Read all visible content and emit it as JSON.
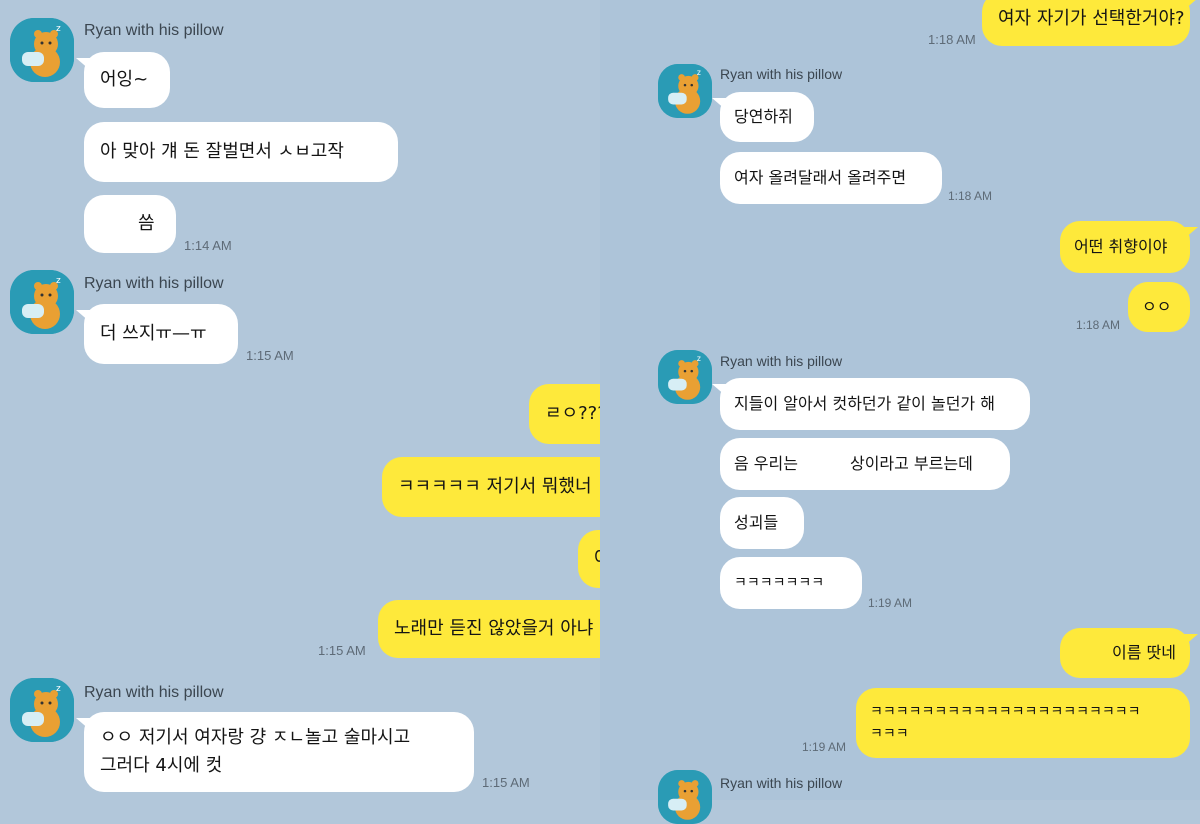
{
  "theme": {
    "background": "#b2c7da",
    "incoming_bubble": "#ffffff",
    "outgoing_bubble": "#fee93b",
    "avatar_bg": "#2a9bb5",
    "avatar_character": "#e9a033",
    "avatar_icon": "ryan-pillow-icon"
  },
  "left": {
    "group1": {
      "sender": "Ryan with his pillow",
      "msgs": [
        "어잉~",
        "아 맞아 걔 돈 잘벌면서 ㅅㅂ고작",
        "씀"
      ],
      "time": "1:14 AM"
    },
    "group2": {
      "sender": "Ryan with his pillow",
      "msgs": [
        "더 쓰지ㅠ—ㅠ"
      ],
      "time": "1:15 AM"
    },
    "group3": {
      "msgs": [
        "ㄹㅇ???",
        "ㅋㅋㅋㅋㅋ 저기서 뭐했너",
        "어",
        "노래만 듣진 않았을거 아냐"
      ],
      "time": "1:15 AM"
    },
    "group4": {
      "sender": "Ryan with his pillow",
      "line1": "ㅇㅇ 저기서 여자랑 걍 ㅈㄴ놀고 술마시고",
      "line2": "그러다 4시에 컷",
      "time": "1:15 AM"
    }
  },
  "right": {
    "top": {
      "msg": "여자 자기가 선택한거야?",
      "time": "1:18 AM"
    },
    "group1": {
      "sender": "Ryan with his pillow",
      "msgs": [
        "당연하쥐",
        "여자 올려달래서 올려주면"
      ],
      "time": "1:18 AM"
    },
    "group2": {
      "msgs": [
        "어떤 취향이야",
        "ㅇㅇ"
      ],
      "time": "1:18 AM"
    },
    "group3": {
      "sender": "Ryan with his pillow",
      "msgs": [
        "지들이 알아서 컷하던가 같이 놀던가 해",
        "음 우리는",
        "상이라고 부르는데",
        "성괴들",
        "ㅋㅋㅋㅋㅋㅋㅋ"
      ],
      "time": "1:19 AM"
    },
    "group4": {
      "msgs": [
        "이름 땃네",
        "ㅋㅋㅋㅋㅋㅋㅋㅋㅋㅋㅋㅋㅋㅋㅋㅋㅋㅋㅋㅋㅋ",
        "ㅋㅋㅋ"
      ],
      "time": "1:19 AM"
    },
    "group5": {
      "sender": "Ryan with his pillow"
    }
  }
}
